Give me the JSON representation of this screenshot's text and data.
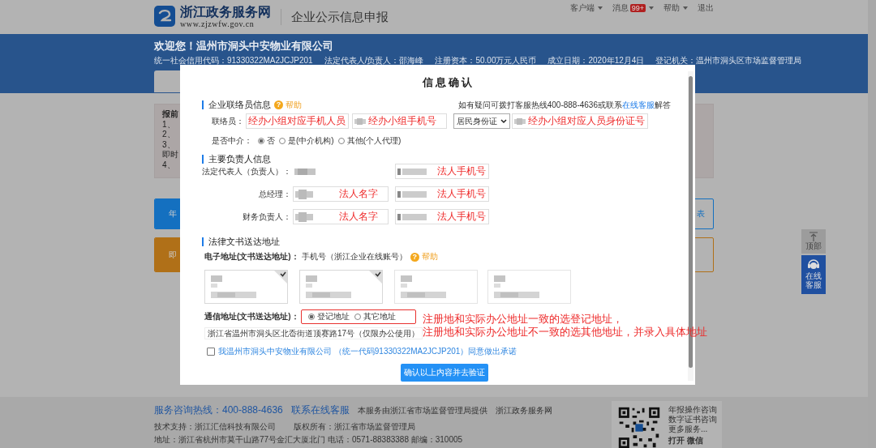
{
  "header": {
    "site_name": "浙江政务服务网",
    "site_url": "www.zjzwfw.gov.cn",
    "app_title": "企业公示信息申报",
    "nav": [
      {
        "label": "客户端",
        "dropdown": true
      },
      {
        "label": "消息",
        "badge": "99+",
        "dropdown": true
      },
      {
        "label": "帮助",
        "dropdown": true
      },
      {
        "label": "退出",
        "dropdown": false
      }
    ]
  },
  "banner": {
    "welcome": "欢迎您！温州市洞头中安物业有限公司",
    "facts": [
      "统一社会信用代码：91330322MA2JCJP201",
      "法定代表人/负责人：邵海峰",
      "注册资本：50.00万元人民币",
      "成立日期：2020年12月4日",
      "登记机关：温州市洞头区市场监督管理局"
    ]
  },
  "background": {
    "notice_lines": [
      "报前",
      "1、",
      "2、",
      "3、",
      "即时",
      "4、"
    ],
    "actions": [
      {
        "left_label": "年",
        "right_label": "表",
        "color": "#1470c0"
      },
      {
        "left_label": "即",
        "color": "#b07018"
      }
    ]
  },
  "side_tools": [
    {
      "kind": "top",
      "label": "顶部"
    },
    {
      "kind": "service",
      "label": "在线客服"
    }
  ],
  "footer": {
    "hotline": "服务咨询热线：400-888-4636",
    "service_link": "联系在线客服",
    "provider": "本服务由浙江省市场监督管理局提供",
    "site": "浙江政务服务网",
    "support": "技术支持：浙江汇信科技有限公司",
    "copyright": "版权所有：浙江省市场监督管理局",
    "address": "地址：浙江省杭州市莫干山路77号金汇大厦北门 电话：0571-88383388 邮编：310005",
    "qr_links": [
      "年报操作咨询",
      "数字证书咨询",
      "更多服务..."
    ],
    "qr_action": "打开 微信"
  },
  "dialog": {
    "title": "信息确认",
    "contact": {
      "heading": "企业联络员信息",
      "help_icon": "?",
      "help": "帮助",
      "note_before": "如有疑问可拨打客服热线400-888-4636或联系",
      "note_link": "在线客服",
      "note_after": "解答",
      "label": "联络员：",
      "fields": [
        {
          "kind": "text",
          "annotation": "经办小组对应手机人员"
        },
        {
          "kind": "text",
          "annotation": "经办小组手机号"
        },
        {
          "kind": "select",
          "value": "居民身份证"
        },
        {
          "kind": "text",
          "annotation": "经办小组对应人员身份证号"
        }
      ],
      "intermediary_label": "是否中介：",
      "intermediary_options": [
        {
          "label": "否",
          "selected": true
        },
        {
          "label": "是(中介机构)",
          "selected": false
        },
        {
          "label": "其他(个人代理)",
          "selected": false
        }
      ]
    },
    "principals": {
      "heading": "主要负责人信息",
      "rows": [
        {
          "role": "法定代表人（负责人）：",
          "name_boxed": false,
          "phone_annotation": "法人手机号"
        },
        {
          "role": "总经理：",
          "name_boxed": true,
          "name_annotation": "法人名字",
          "phone_annotation": "法人手机号"
        },
        {
          "role": "财务负责人：",
          "name_boxed": true,
          "name_annotation": "法人名字",
          "phone_annotation": "法人手机号"
        }
      ]
    },
    "delivery": {
      "heading": "法律文书送达地址",
      "electronic_label": "电子地址(文书送达地址)：",
      "electronic_value": "手机号（浙江企业在线账号）",
      "help_icon": "?",
      "help": "帮助",
      "cards": [
        {
          "selected": true
        },
        {
          "selected": true
        },
        {
          "selected": false
        },
        {
          "selected": false
        }
      ],
      "postal_label": "通信地址(文书送达地址)：",
      "postal_options": [
        {
          "label": "登记地址",
          "selected": true
        },
        {
          "label": "其它地址",
          "selected": false
        }
      ],
      "annotation_lines": [
        "注册地和实际办公地址一致的选登记地址，",
        "注册地和实际办公地址不一致的选其他地址，并录入具体地址"
      ],
      "address": "浙江省温州市洞头区北岙街道顶赛路17号（仅限办公使用）"
    },
    "pledge": {
      "checked": false,
      "text": "我温州市洞头中安物业有限公司 （统一代码91330322MA2JCJP201）同意做出承诺"
    },
    "confirm_button": "确认以上内容并去验证"
  }
}
